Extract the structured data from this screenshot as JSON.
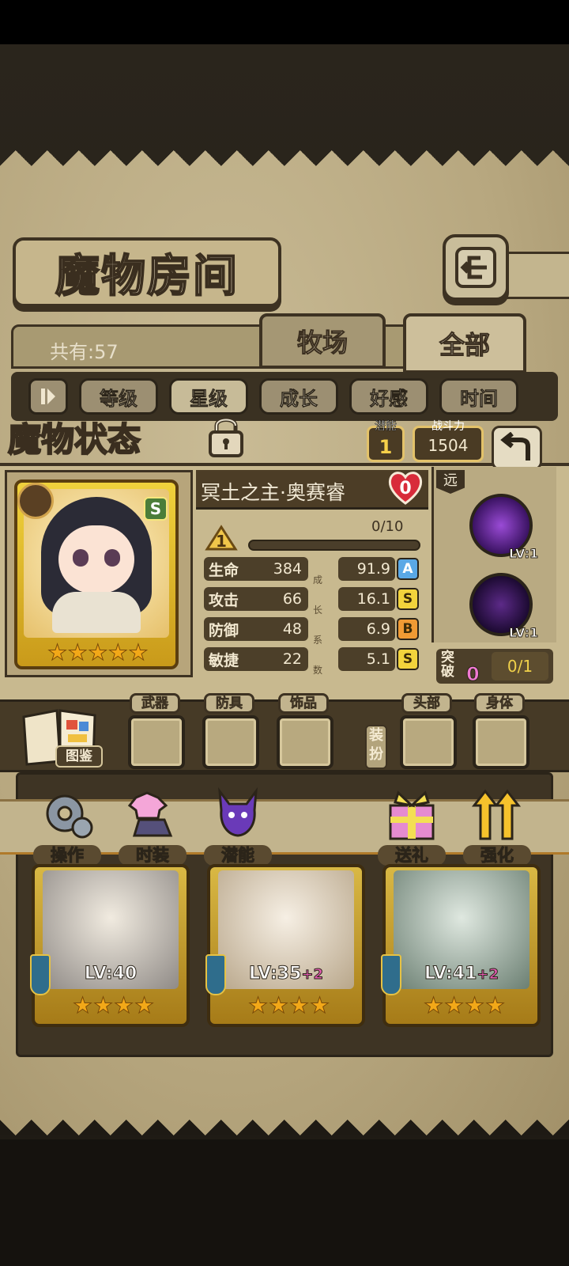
{
  "screen": {
    "title": "魔物房间",
    "count_label": "共有:57",
    "tabs": [
      {
        "label": "牧场"
      },
      {
        "label": "全部"
      }
    ],
    "sort_buttons": [
      "等级",
      "星级",
      "成长",
      "好感",
      "时间"
    ]
  },
  "status_panel": {
    "title": "魔物状态",
    "potential_label": "潜能",
    "potential_value": "1",
    "power_label": "战斗力",
    "power_value": "1504",
    "monster": {
      "name": "冥土之主·奥赛睿",
      "affinity": "0",
      "rank": "S",
      "stars": 5,
      "level": "1",
      "exp": "0/10",
      "exp_fraction": 0
    },
    "stats": [
      {
        "label": "生命",
        "value": "384",
        "growth": "91.9",
        "grade": "A"
      },
      {
        "label": "攻击",
        "value": "66",
        "growth": "16.1",
        "grade": "S"
      },
      {
        "label": "防御",
        "value": "48",
        "growth": "6.9",
        "grade": "B"
      },
      {
        "label": "敏捷",
        "value": "22",
        "growth": "5.1",
        "grade": "S"
      }
    ],
    "growth_chars": [
      "成",
      "长",
      "系",
      "数"
    ],
    "range_label": "远",
    "skills": [
      {
        "level": "LV:1",
        "icon": "lightning-skill-icon"
      },
      {
        "level": "LV:1",
        "icon": "shadow-skill-icon"
      }
    ],
    "break": {
      "label": "突破",
      "count": "0",
      "value": "0/1"
    }
  },
  "equipment": {
    "book_label": "图鉴",
    "slots": [
      "武器",
      "防具",
      "饰品",
      "头部",
      "身体"
    ],
    "vertical_label": "装扮"
  },
  "actions": [
    {
      "label": "操作",
      "icon": "gear-icon"
    },
    {
      "label": "时装",
      "icon": "outfit-icon"
    },
    {
      "label": "潜能",
      "icon": "demon-icon"
    },
    {
      "label": "送礼",
      "icon": "gift-icon"
    },
    {
      "label": "强化",
      "icon": "upgrade-arrows-icon"
    }
  ],
  "cards": [
    {
      "level": "LV:40",
      "plus": "",
      "stars": 4
    },
    {
      "level": "LV:35",
      "plus": "+2",
      "stars": 4
    },
    {
      "level": "LV:41",
      "plus": "+2",
      "stars": 4
    }
  ],
  "colors": {
    "gold": "#e3c26a",
    "parchment": "#c8b98f",
    "dark_brown": "#3d3222",
    "pink": "#e65ab4"
  }
}
